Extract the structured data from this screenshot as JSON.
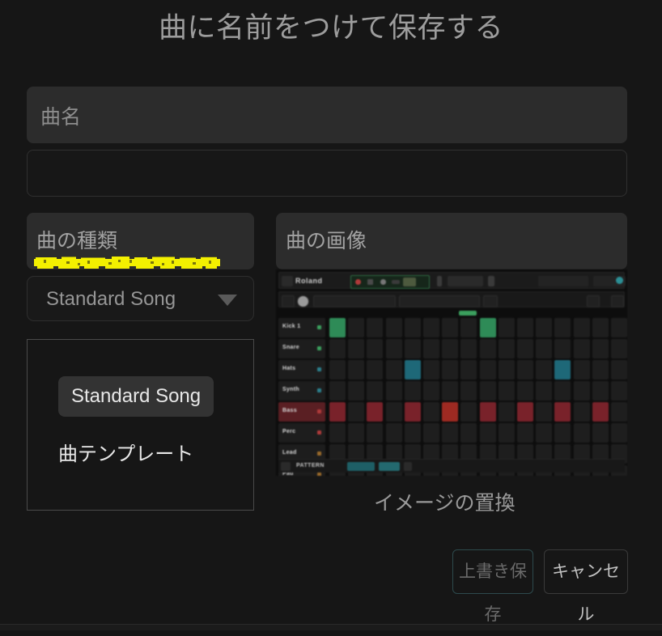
{
  "dialog": {
    "title": "曲に名前をつけて保存する"
  },
  "song_name_field": {
    "placeholder": "曲名",
    "value": ""
  },
  "secondary_field": {
    "placeholder": "",
    "value": ""
  },
  "song_type": {
    "label": "曲の種類",
    "selected": "Standard Song",
    "caret_icon": "chevron-down-icon",
    "annotation": {
      "type": "highlighter-scribble",
      "color": "#f3f000"
    },
    "menu_options": [
      {
        "label": "Standard Song",
        "selected": true
      },
      {
        "label": "曲テンプレート",
        "selected": false
      }
    ]
  },
  "song_image": {
    "label": "曲の画像",
    "replace_label": "イメージの置換",
    "preview": {
      "brand": "Roland",
      "rows": [
        {
          "name": "track-1",
          "label": "Kick 1",
          "dot": "#3ba05e",
          "highlight": false,
          "steps": [
            1,
            0,
            0,
            0,
            0,
            0,
            0,
            0,
            1,
            0,
            0,
            0,
            0,
            0,
            0,
            0
          ],
          "cell_color": "#2e8b57"
        },
        {
          "name": "track-2",
          "label": "Snare",
          "dot": "#3ba05e",
          "highlight": false,
          "steps": [
            0,
            0,
            0,
            0,
            0,
            0,
            0,
            0,
            0,
            0,
            0,
            0,
            0,
            0,
            0,
            0
          ],
          "cell_color": "#2e8b57"
        },
        {
          "name": "track-3",
          "label": "Hats",
          "dot": "#2b7f8c",
          "highlight": false,
          "steps": [
            0,
            0,
            0,
            0,
            1,
            0,
            0,
            0,
            0,
            0,
            0,
            0,
            1,
            0,
            0,
            0
          ],
          "cell_color": "#1e6878"
        },
        {
          "name": "track-4",
          "label": "Synth",
          "dot": "#2b7f8c",
          "highlight": false,
          "steps": [
            0,
            0,
            0,
            0,
            0,
            0,
            0,
            0,
            0,
            0,
            0,
            0,
            0,
            0,
            0,
            0
          ],
          "cell_color": "#1e6878"
        },
        {
          "name": "track-5",
          "label": "Bass",
          "dot": "#b03a3a",
          "highlight": true,
          "steps": [
            1,
            0,
            1,
            0,
            1,
            0,
            1,
            0,
            1,
            0,
            1,
            0,
            1,
            0,
            1,
            0
          ],
          "cell_color": "#79222a"
        },
        {
          "name": "track-6",
          "label": "Perc",
          "dot": "#b03a3a",
          "highlight": false,
          "steps": [
            0,
            0,
            0,
            0,
            0,
            0,
            0,
            0,
            0,
            0,
            0,
            0,
            0,
            0,
            0,
            0
          ],
          "cell_color": "#79222a"
        },
        {
          "name": "track-7",
          "label": "Lead",
          "dot": "#9a6a2a",
          "highlight": false,
          "steps": [
            0,
            0,
            0,
            0,
            0,
            0,
            0,
            0,
            0,
            0,
            0,
            0,
            0,
            0,
            0,
            0
          ],
          "cell_color": "#7a5420"
        },
        {
          "name": "track-8",
          "label": "Pad",
          "dot": "#9a6a2a",
          "highlight": false,
          "steps": [
            0,
            0,
            0,
            0,
            0,
            0,
            0,
            0,
            0,
            0,
            0,
            0,
            0,
            0,
            0,
            0
          ],
          "cell_color": "#7a5420"
        }
      ],
      "step_count": 16,
      "playhead_step": 8
    }
  },
  "footer": {
    "save_label": "上書き保存",
    "save_enabled": false,
    "cancel_label": "キャンセル"
  },
  "colors": {
    "background": "#161616",
    "field": "#2c2c2c",
    "text_muted": "#9d9d9d",
    "accent_teal": "#2d4a4d",
    "highlighter_yellow": "#f3f000"
  }
}
